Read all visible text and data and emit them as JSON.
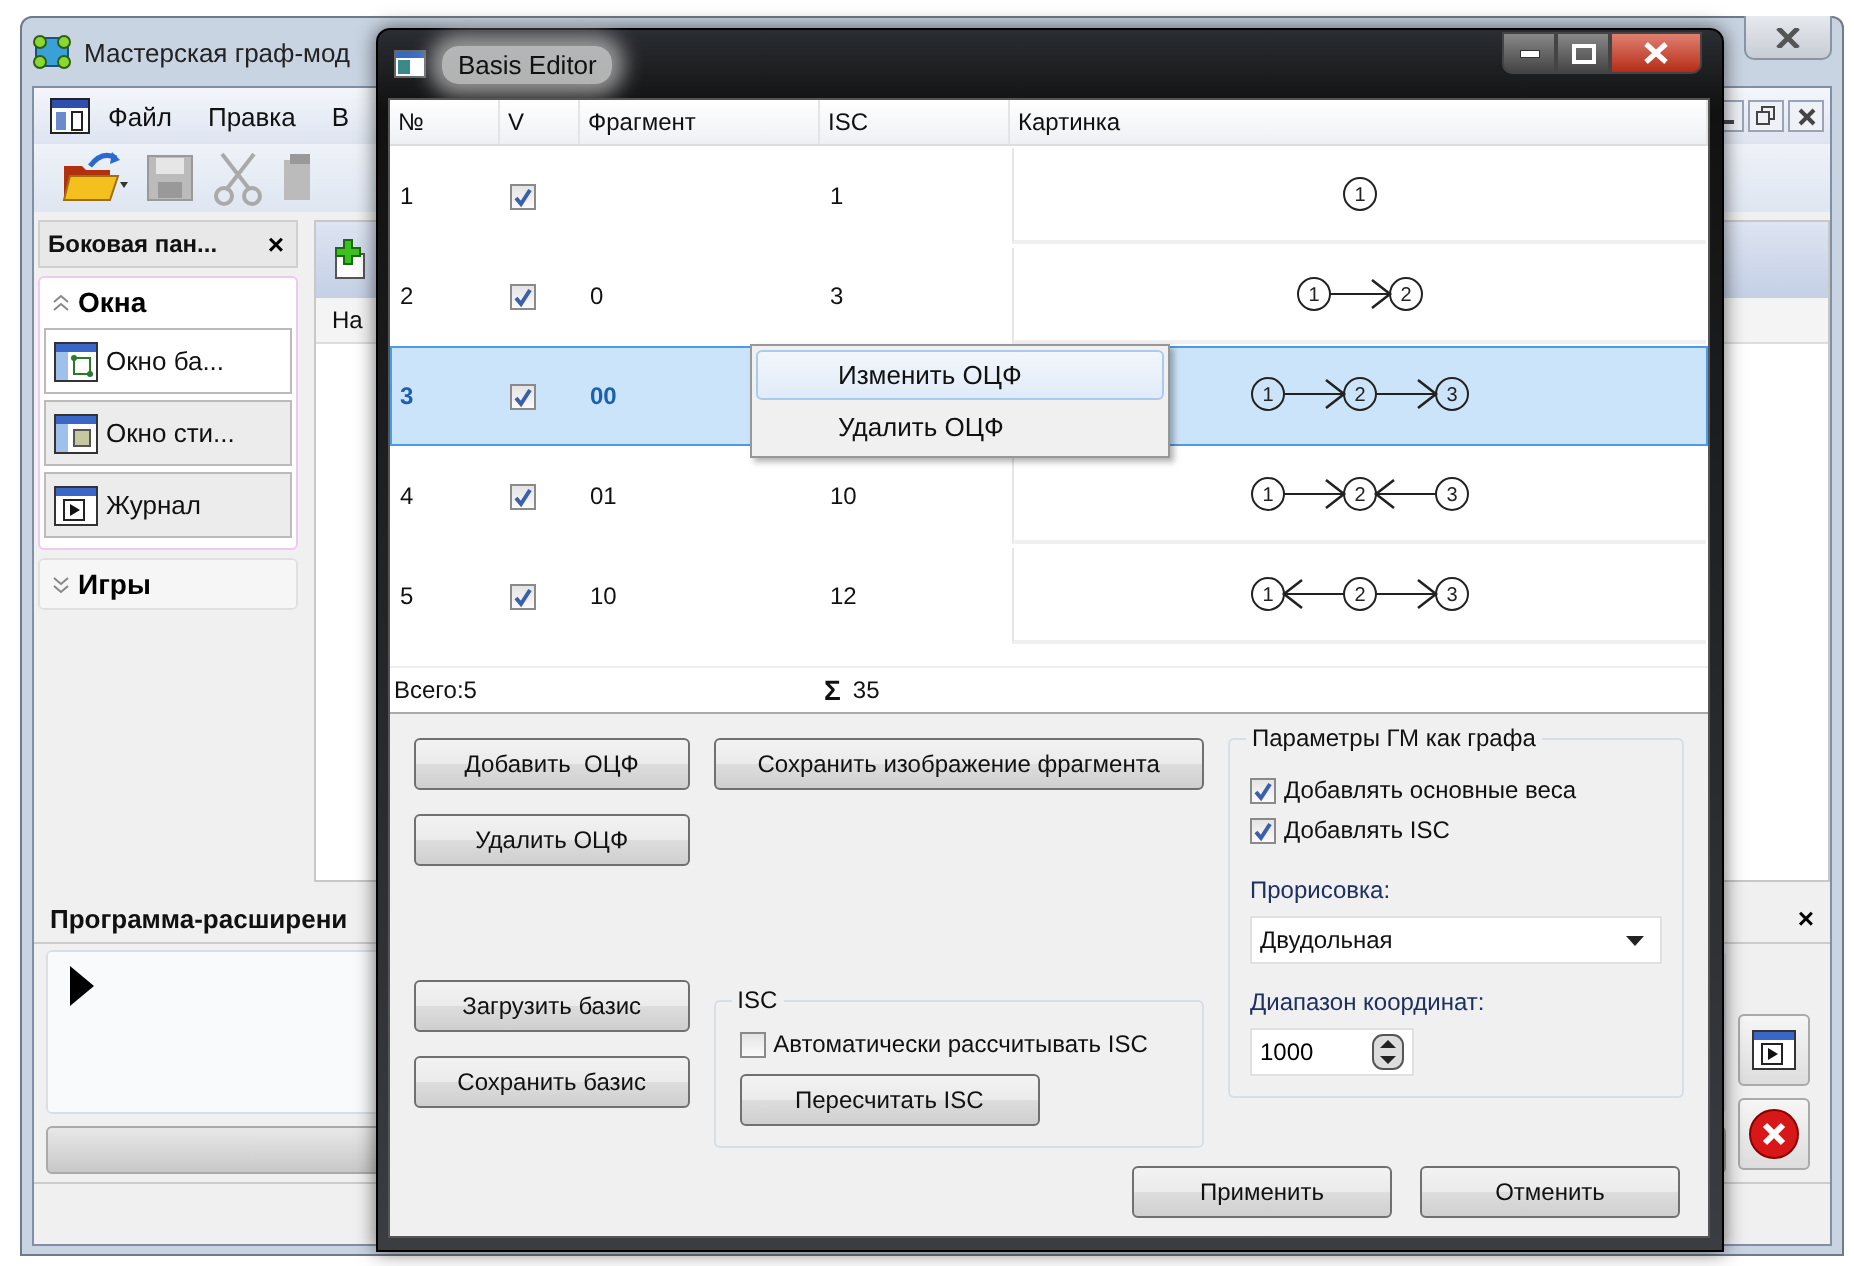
{
  "main_window": {
    "title": "Мастерская граф-мод",
    "menu": [
      "Файл",
      "Правка",
      "В"
    ],
    "sidebar": {
      "title": "Боковая пан...",
      "close": "×",
      "sections": [
        {
          "label": "Окна",
          "expanded": true,
          "items": [
            {
              "label": "Окно ба...",
              "kind": "graph",
              "selected": true
            },
            {
              "label": "Окно сти...",
              "kind": "style",
              "selected": false
            },
            {
              "label": "Журнал",
              "kind": "log",
              "selected": false
            }
          ]
        },
        {
          "label": "Игры",
          "expanded": false
        }
      ]
    },
    "document": {
      "column_1": "На"
    },
    "extension_panel": {
      "title": "Программа-расширени",
      "close": "×",
      "progress": {
        "level": 0
      }
    }
  },
  "dialog": {
    "title": "Basis Editor",
    "table": {
      "columns": [
        "№",
        "V",
        "Фрагмент",
        "ISC",
        "Картинка"
      ],
      "rows": [
        {
          "number": "1",
          "checked": true,
          "isc": "1",
          "selected": false,
          "graph": {
            "nodes": [
              "1"
            ]
          }
        },
        {
          "number": "2",
          "checked": true,
          "fragment": "0",
          "isc": "3",
          "selected": false,
          "graph": {
            "nodes": [
              "1",
              "2"
            ],
            "edges": [
              {
                "kind": "forward"
              }
            ]
          }
        },
        {
          "number": "3",
          "checked": true,
          "fragment": "00",
          "selected": true,
          "graph": {
            "nodes": [
              "1",
              "2",
              "3"
            ],
            "edges": [
              {
                "kind": "forward"
              },
              {
                "kind": "forward"
              }
            ]
          }
        },
        {
          "number": "4",
          "checked": true,
          "fragment": "01",
          "isc": "10",
          "selected": false,
          "graph": {
            "nodes": [
              "1",
              "2",
              "3"
            ],
            "edges": [
              {
                "kind": "forward"
              },
              {
                "kind": "backward"
              }
            ]
          }
        },
        {
          "number": "5",
          "checked": true,
          "fragment": "10",
          "isc": "12",
          "selected": false,
          "graph": {
            "nodes": [
              "1",
              "2",
              "3"
            ],
            "edges": [
              {
                "kind": "backward"
              },
              {
                "kind": "forward"
              }
            ]
          }
        }
      ],
      "total": "Всего:5",
      "sum_symbol": "Σ",
      "sum": "35"
    },
    "context_menu": [
      {
        "label": "Изменить ОЦФ",
        "selected": true
      },
      {
        "label": "Удалить ОЦФ",
        "selected": false
      }
    ],
    "buttons": {
      "add": "Добавить  ОЦФ",
      "save_image": "Сохранить изображение фрагмента",
      "delete": "Удалить ОЦФ",
      "load": "Загрузить базис",
      "save": "Сохранить базис"
    },
    "isc_group": {
      "title": "ISC",
      "auto": {
        "label": "Автоматически рассчитывать ISC",
        "checked": false
      },
      "button": "Пересчитать ISC"
    },
    "params_group": {
      "title": "Параметры ГМ как графа",
      "options": [
        {
          "label": "Добавлять основные веса",
          "checked": true
        },
        {
          "label": "Добавлять ISC",
          "checked": true
        }
      ],
      "drawing_label": "Прорисовка:",
      "drawing_value": "Двудольная",
      "range_label": "Диапазон координат:",
      "range_value": "1000"
    },
    "actions": [
      "Применить",
      "Отменить"
    ]
  }
}
